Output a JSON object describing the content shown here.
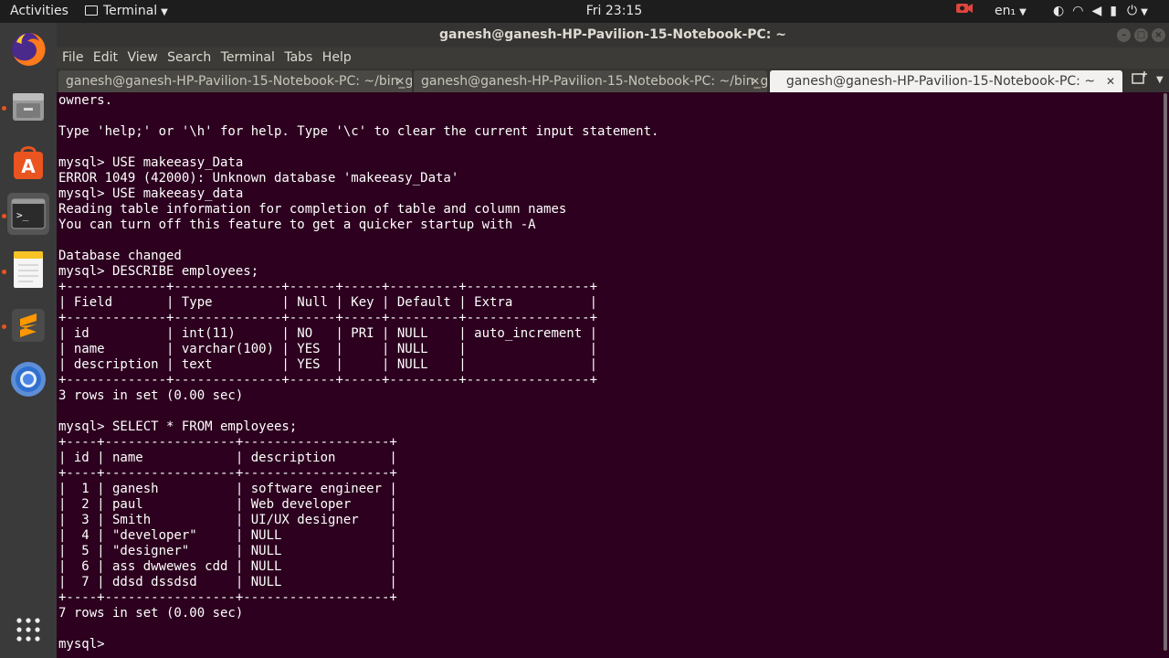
{
  "topbar": {
    "activities": "Activities",
    "app_name": "Terminal",
    "clock": "Fri 23:15",
    "language": "en",
    "icons": [
      "camera-record-icon",
      "night-light-icon",
      "wifi-icon",
      "volume-icon",
      "battery-icon",
      "power-icon"
    ]
  },
  "dock": {
    "items": [
      "firefox-icon",
      "files-icon",
      "software-center-icon",
      "terminal-icon",
      "text-editor-icon",
      "sublime-text-icon",
      "chrome-icon",
      "show-apps-icon"
    ]
  },
  "window": {
    "title": "ganesh@ganesh-HP-Pavilion-15-Notebook-PC: ~",
    "menu": [
      "File",
      "Edit",
      "View",
      "Search",
      "Terminal",
      "Tabs",
      "Help"
    ],
    "tabs": [
      {
        "label": "ganesh@ganesh-HP-Pavilion-15-Notebook-PC: ~/bin_g..."
      },
      {
        "label": "ganesh@ganesh-HP-Pavilion-15-Notebook-PC: ~/bin_g..."
      },
      {
        "label": "ganesh@ganesh-HP-Pavilion-15-Notebook-PC: ~"
      }
    ],
    "active_tab_index": 2
  },
  "terminal": {
    "lines": [
      "owners.",
      "",
      "Type 'help;' or '\\h' for help. Type '\\c' to clear the current input statement.",
      "",
      "mysql> USE makeeasy_Data",
      "ERROR 1049 (42000): Unknown database 'makeeasy_Data'",
      "mysql> USE makeeasy_data",
      "Reading table information for completion of table and column names",
      "You can turn off this feature to get a quicker startup with -A",
      "",
      "Database changed",
      "mysql> DESCRIBE employees;",
      "+-------------+--------------+------+-----+---------+----------------+",
      "| Field       | Type         | Null | Key | Default | Extra          |",
      "+-------------+--------------+------+-----+---------+----------------+",
      "| id          | int(11)      | NO   | PRI | NULL    | auto_increment |",
      "| name        | varchar(100) | YES  |     | NULL    |                |",
      "| description | text         | YES  |     | NULL    |                |",
      "+-------------+--------------+------+-----+---------+----------------+",
      "3 rows in set (0.00 sec)",
      "",
      "mysql> SELECT * FROM employees;",
      "+----+-----------------+-------------------+",
      "| id | name            | description       |",
      "+----+-----------------+-------------------+",
      "|  1 | ganesh          | software engineer |",
      "|  2 | paul            | Web developer     |",
      "|  3 | Smith           | UI/UX designer    |",
      "|  4 | \"developer\"     | NULL              |",
      "|  5 | \"designer\"      | NULL              |",
      "|  6 | ass dwwewes cdd | NULL              |",
      "|  7 | ddsd dssdsd     | NULL              |",
      "+----+-----------------+-------------------+",
      "7 rows in set (0.00 sec)",
      "",
      "mysql> "
    ]
  }
}
